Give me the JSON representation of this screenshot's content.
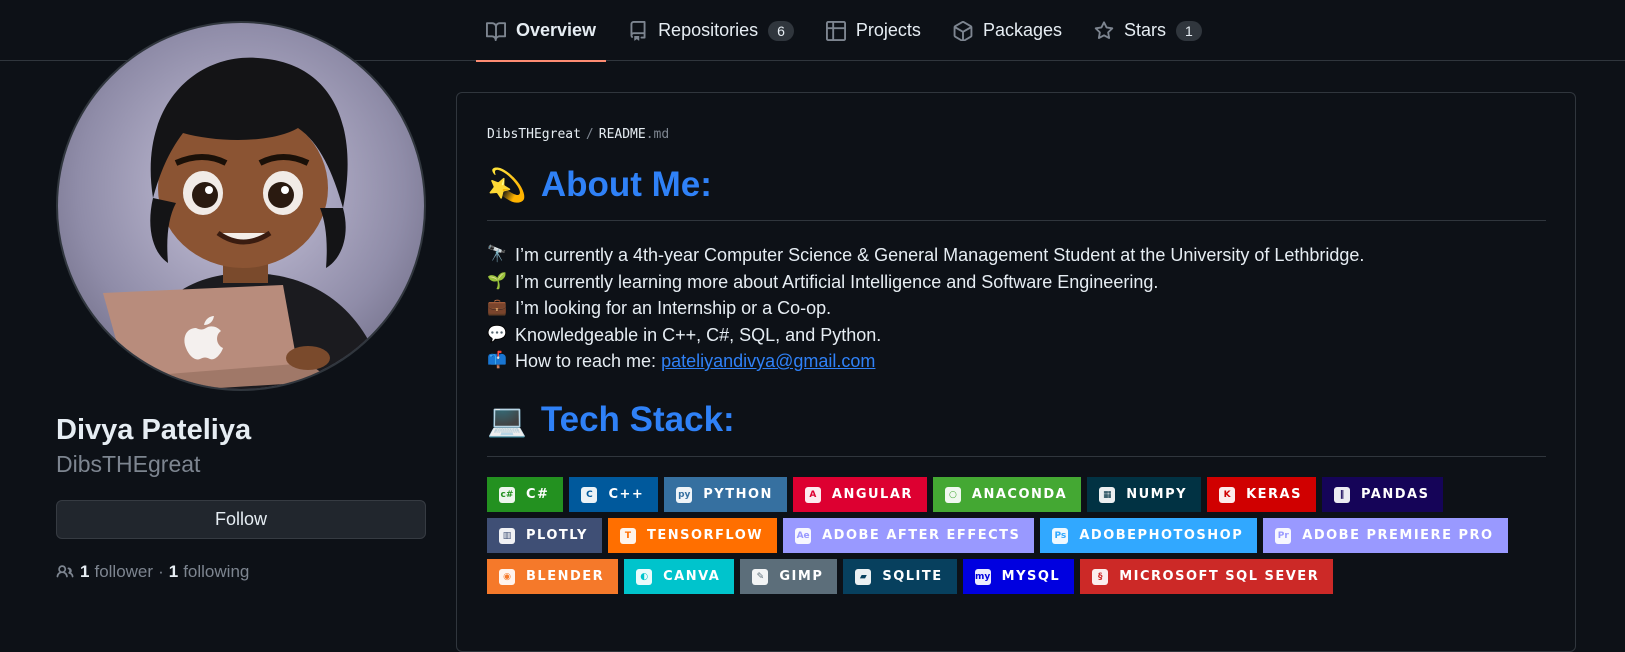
{
  "nav": {
    "tabs": [
      {
        "label": "Overview",
        "icon": "book-icon",
        "active": true
      },
      {
        "label": "Repositories",
        "icon": "repo-icon",
        "count": "6"
      },
      {
        "label": "Projects",
        "icon": "project-table-icon"
      },
      {
        "label": "Packages",
        "icon": "package-icon"
      },
      {
        "label": "Stars",
        "icon": "star-icon",
        "count": "1"
      }
    ]
  },
  "profile": {
    "name": "Divya Pateliya",
    "login": "DibsTHEgreat",
    "follow_label": "Follow",
    "followers_count": "1",
    "followers_label": "follower",
    "separator": "·",
    "following_count": "1",
    "following_label": "following"
  },
  "readme": {
    "owner": "DibsTHEgreat",
    "sep": "/",
    "file": "README",
    "ext": ".md",
    "about": {
      "emoji": "💫",
      "heading": "About Me:",
      "lines": [
        {
          "emoji": "🔭",
          "text": "I’m currently a 4th-year Computer Science & General Management Student at the University of Lethbridge."
        },
        {
          "emoji": "🌱",
          "text": "I’m currently learning more about Artificial Intelligence and Software Engineering."
        },
        {
          "emoji": "💼",
          "text": "I’m looking for an Internship or a Co-op."
        },
        {
          "emoji": "💬",
          "text": "Knowledgeable in C++, C#, SQL, and Python."
        },
        {
          "emoji": "📫",
          "text": "How to reach me:",
          "link": "pateliyandivya@gmail.com"
        }
      ]
    },
    "tech": {
      "emoji": "💻",
      "heading": "Tech Stack:",
      "rows": [
        [
          {
            "label": "C#",
            "color": "#239120",
            "icon": "c#"
          },
          {
            "label": "C++",
            "color": "#00599C",
            "icon": "C"
          },
          {
            "label": "PYTHON",
            "color": "#3670A0",
            "icon": "py"
          },
          {
            "label": "ANGULAR",
            "color": "#DD0031",
            "icon": "A"
          },
          {
            "label": "ANACONDA",
            "color": "#44A833",
            "icon": "○"
          },
          {
            "label": "NUMPY",
            "color": "#013243",
            "icon": "▦"
          },
          {
            "label": "KERAS",
            "color": "#D00000",
            "icon": "K"
          },
          {
            "label": "PANDAS",
            "color": "#150458",
            "icon": "‖"
          }
        ],
        [
          {
            "label": "PLOTLY",
            "color": "#3F4F75",
            "icon": "▥"
          },
          {
            "label": "TENSORFLOW",
            "color": "#FF6F00",
            "icon": "T"
          },
          {
            "label": "ADOBE AFTER EFFECTS",
            "color": "#9999FF",
            "icon": "Ae"
          },
          {
            "label": "ADOBEPHOTOSHOP",
            "color": "#31A8FF",
            "icon": "Ps"
          },
          {
            "label": "ADOBE PREMIERE PRO",
            "color": "#9999FF",
            "icon": "Pr"
          }
        ],
        [
          {
            "label": "BLENDER",
            "color": "#F5792A",
            "icon": "◉"
          },
          {
            "label": "CANVA",
            "color": "#00C4CC",
            "icon": "◐"
          },
          {
            "label": "GIMP",
            "color": "#5C6E7A",
            "icon": "✎"
          },
          {
            "label": "SQLITE",
            "color": "#07405E",
            "icon": "▰"
          },
          {
            "label": "MYSQL",
            "color": "#0000E0",
            "icon": "my"
          },
          {
            "label": "MICROSOFT SQL SEVER",
            "color": "#CC2927",
            "icon": "§"
          }
        ]
      ]
    }
  }
}
